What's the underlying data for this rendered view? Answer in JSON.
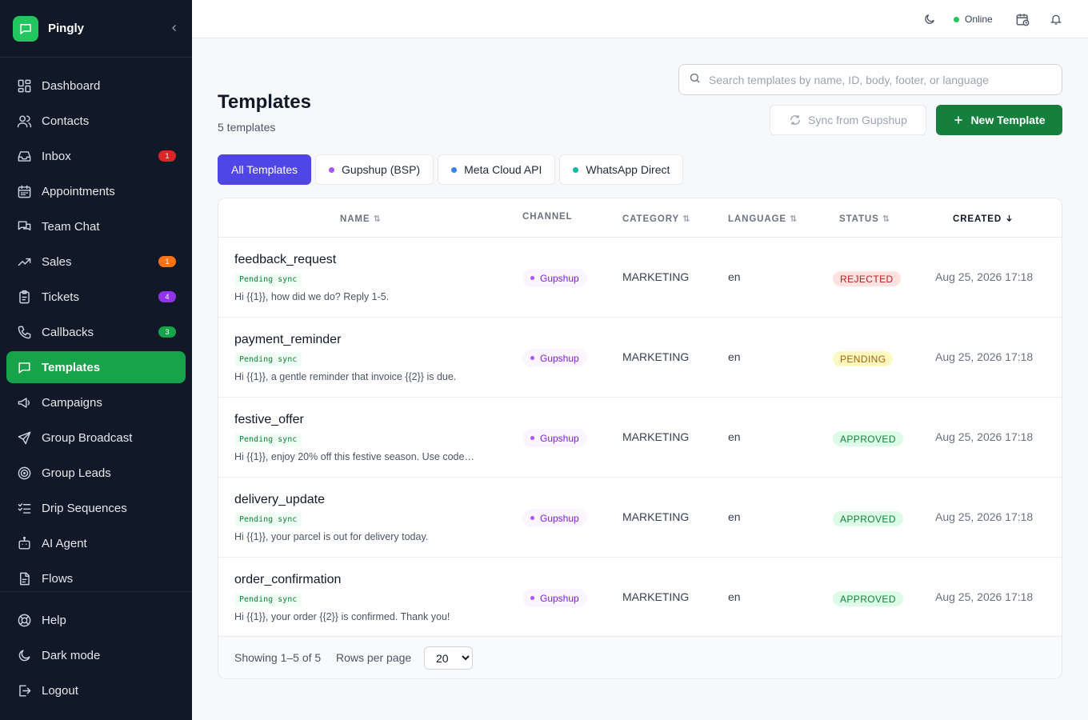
{
  "app": {
    "name": "Pingly"
  },
  "header": {
    "status": "Online"
  },
  "sidebar": {
    "items": [
      {
        "label": "Dashboard",
        "icon": "dashboard-icon",
        "name": "dashboard"
      },
      {
        "label": "Contacts",
        "icon": "users-icon",
        "name": "contacts"
      },
      {
        "label": "Inbox",
        "icon": "inbox-icon",
        "name": "inbox",
        "badge": "1",
        "badge_color": "#dc2626"
      },
      {
        "label": "Appointments",
        "icon": "calendar-icon",
        "name": "appointments"
      },
      {
        "label": "Team Chat",
        "icon": "chat-icon",
        "name": "team-chat"
      },
      {
        "label": "Sales",
        "icon": "trending-up-icon",
        "name": "sales",
        "badge": "1",
        "badge_color": "#f97316"
      },
      {
        "label": "Tickets",
        "icon": "clipboard-icon",
        "name": "tickets",
        "badge": "4",
        "badge_color": "#9333ea"
      },
      {
        "label": "Callbacks",
        "icon": "phone-icon",
        "name": "callbacks",
        "badge": "3",
        "badge_color": "#16a34a"
      },
      {
        "label": "Templates",
        "icon": "message-square-icon",
        "name": "templates",
        "active": true
      },
      {
        "label": "Campaigns",
        "icon": "megaphone-icon",
        "name": "campaigns"
      },
      {
        "label": "Group Broadcast",
        "icon": "send-icon",
        "name": "group-broadcast"
      },
      {
        "label": "Group Leads",
        "icon": "target-icon",
        "name": "group-leads"
      },
      {
        "label": "Drip Sequences",
        "icon": "list-checks-icon",
        "name": "drip-sequences"
      },
      {
        "label": "AI Agent",
        "icon": "bot-icon",
        "name": "ai-agent"
      },
      {
        "label": "Flows",
        "icon": "file-flow-icon",
        "name": "flows"
      }
    ],
    "footer": [
      {
        "label": "Help",
        "icon": "help-icon",
        "name": "help"
      },
      {
        "label": "Dark mode",
        "icon": "moon-icon",
        "name": "dark-mode"
      },
      {
        "label": "Logout",
        "icon": "logout-icon",
        "name": "logout"
      }
    ]
  },
  "page": {
    "title": "Templates",
    "subtitle": "5 templates",
    "search_placeholder": "Search templates by name, ID, body, footer, or language",
    "sync_label": "Sync from Gupshup",
    "new_label": "New Template"
  },
  "filters": [
    {
      "label": "All Templates",
      "active": true
    },
    {
      "label": "Gupshup (BSP)",
      "dot": "#a855f7"
    },
    {
      "label": "Meta Cloud API",
      "dot": "#3b82f6"
    },
    {
      "label": "WhatsApp Direct",
      "dot": "#14b8a6"
    }
  ],
  "table": {
    "columns": {
      "name": "NAME",
      "channel": "CHANNEL",
      "category": "CATEGORY",
      "language": "LANGUAGE",
      "status": "STATUS",
      "created": "CREATED"
    },
    "rows": [
      {
        "name": "feedback_request",
        "sync": "Pending sync",
        "body": "Hi {{1}}, how did we do? Reply 1-5.",
        "channel": "Gupshup",
        "category": "MARKETING",
        "language": "en",
        "status": "REJECTED",
        "status_bg": "#fee2e2",
        "status_fg": "#b91c1c",
        "created": "Aug 25, 2026 17:18"
      },
      {
        "name": "payment_reminder",
        "sync": "Pending sync",
        "body": "Hi {{1}}, a gentle reminder that invoice {{2}} is due.",
        "channel": "Gupshup",
        "category": "MARKETING",
        "language": "en",
        "status": "PENDING",
        "status_bg": "#fef9c3",
        "status_fg": "#a16207",
        "created": "Aug 25, 2026 17:18"
      },
      {
        "name": "festive_offer",
        "sync": "Pending sync",
        "body": "Hi {{1}}, enjoy 20% off this festive season. Use code…",
        "channel": "Gupshup",
        "category": "MARKETING",
        "language": "en",
        "status": "APPROVED",
        "status_bg": "#dcfce7",
        "status_fg": "#15803d",
        "created": "Aug 25, 2026 17:18"
      },
      {
        "name": "delivery_update",
        "sync": "Pending sync",
        "body": "Hi {{1}}, your parcel is out for delivery today.",
        "channel": "Gupshup",
        "category": "MARKETING",
        "language": "en",
        "status": "APPROVED",
        "status_bg": "#dcfce7",
        "status_fg": "#15803d",
        "created": "Aug 25, 2026 17:18"
      },
      {
        "name": "order_confirmation",
        "sync": "Pending sync",
        "body": "Hi {{1}}, your order {{2}} is confirmed. Thank you!",
        "channel": "Gupshup",
        "category": "MARKETING",
        "language": "en",
        "status": "APPROVED",
        "status_bg": "#dcfce7",
        "status_fg": "#15803d",
        "created": "Aug 25, 2026 17:18"
      }
    ],
    "footer": {
      "showing": "Showing 1–5 of 5",
      "rows_per_page_label": "Rows per page",
      "rows_per_page": "20"
    }
  },
  "colors": {
    "sidebar_bg": "#111827",
    "active_green": "#16a34a",
    "primary_button": "#15803d",
    "active_filter": "#4f46e5"
  }
}
